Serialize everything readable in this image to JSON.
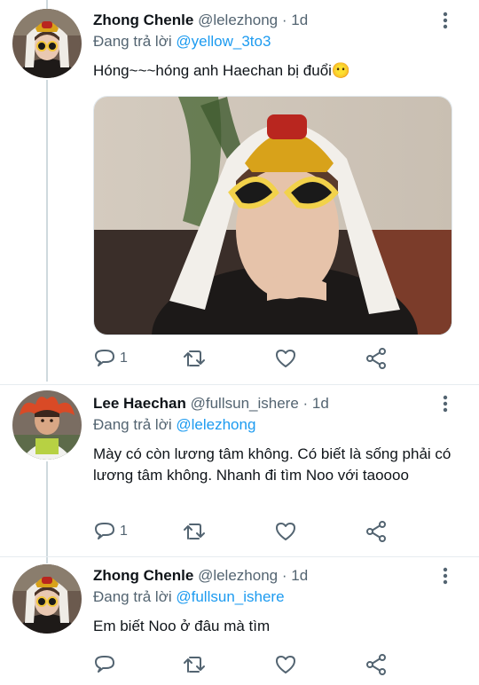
{
  "tweets": [
    {
      "display_name": "Zhong Chenle",
      "handle": "@lelezhong",
      "dot": "·",
      "time": "1d",
      "reply_prefix": "Đang trả lời",
      "reply_to": "@yellow_3to3",
      "text": "Hóng~~~hóng anh Haechan bị đuổi😶",
      "reply_count": "1"
    },
    {
      "display_name": "Lee Haechan",
      "handle": "@fullsun_ishere",
      "dot": "·",
      "time": "1d",
      "reply_prefix": "Đang trả lời",
      "reply_to": "@lelezhong",
      "text": "Mày có còn lương tâm không. Có biết là sống phải có lương tâm không. Nhanh đi tìm Noo với taoooo",
      "reply_count": "1"
    },
    {
      "display_name": "Zhong Chenle",
      "handle": "@lelezhong",
      "dot": "·",
      "time": "1d",
      "reply_prefix": "Đang trả lời",
      "reply_to": "@fullsun_ishere",
      "text": "Em biết Noo ở đâu mà tìm",
      "reply_count": ""
    }
  ],
  "colors": {
    "link": "#1d9bf0",
    "secondary_text": "#536471",
    "thread_line": "#cfd9de"
  },
  "icons": [
    "more-vertical-icon",
    "reply-icon",
    "retweet-icon",
    "like-icon",
    "share-icon"
  ]
}
